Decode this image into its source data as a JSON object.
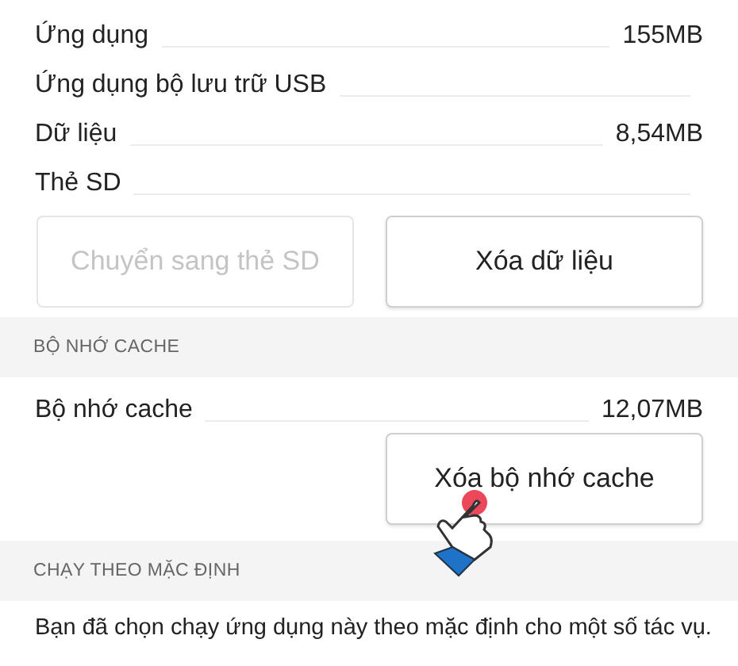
{
  "storage": {
    "rows": [
      {
        "label": "Ứng dụng",
        "value": "155MB"
      },
      {
        "label": "Ứng dụng bộ lưu trữ USB"
      },
      {
        "label": "Dữ liệu",
        "value": "8,54MB"
      },
      {
        "label": "Thẻ SD"
      }
    ],
    "buttons": [
      {
        "label": "Chuyển sang thẻ SD",
        "disabled": true
      },
      {
        "label": "Xóa dữ liệu",
        "disabled": false
      }
    ]
  },
  "cache": {
    "header": "BỘ NHỚ CACHE",
    "rows": [
      {
        "label": "Bộ nhớ cache",
        "value": "12,07MB"
      }
    ],
    "buttons": [
      {
        "label": "Xóa bộ nhớ cache",
        "disabled": false,
        "tapped": true
      }
    ]
  },
  "defaults": {
    "header": "CHẠY THEO MẶC ĐỊNH",
    "text": "Bạn đã chọn chạy ứng dụng này theo mặc định cho một số tác vụ."
  }
}
